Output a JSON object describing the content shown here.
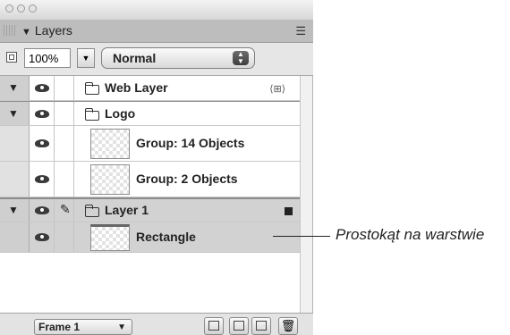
{
  "panel": {
    "title": "Layers",
    "options_icon": "panel-menu-icon"
  },
  "controls": {
    "opacity": "100%",
    "blend_mode": "Normal"
  },
  "layers": [
    {
      "name": "Web Layer",
      "type": "folder",
      "expanded": true
    },
    {
      "name": "Logo",
      "type": "folder",
      "expanded": true
    },
    {
      "name": "Group: 14 Objects",
      "type": "object"
    },
    {
      "name": "Group: 2 Objects",
      "type": "object"
    },
    {
      "name": "Layer 1",
      "type": "folder",
      "expanded": true,
      "editable": true
    },
    {
      "name": "Rectangle",
      "type": "object",
      "selected": true
    }
  ],
  "bottom": {
    "frame_label": "Frame 1"
  },
  "callout": {
    "text": "Prostokąt na warstwie"
  },
  "colors": {
    "panel_bg": "#e9e9e9",
    "selected_row": "#d2d2d2"
  }
}
